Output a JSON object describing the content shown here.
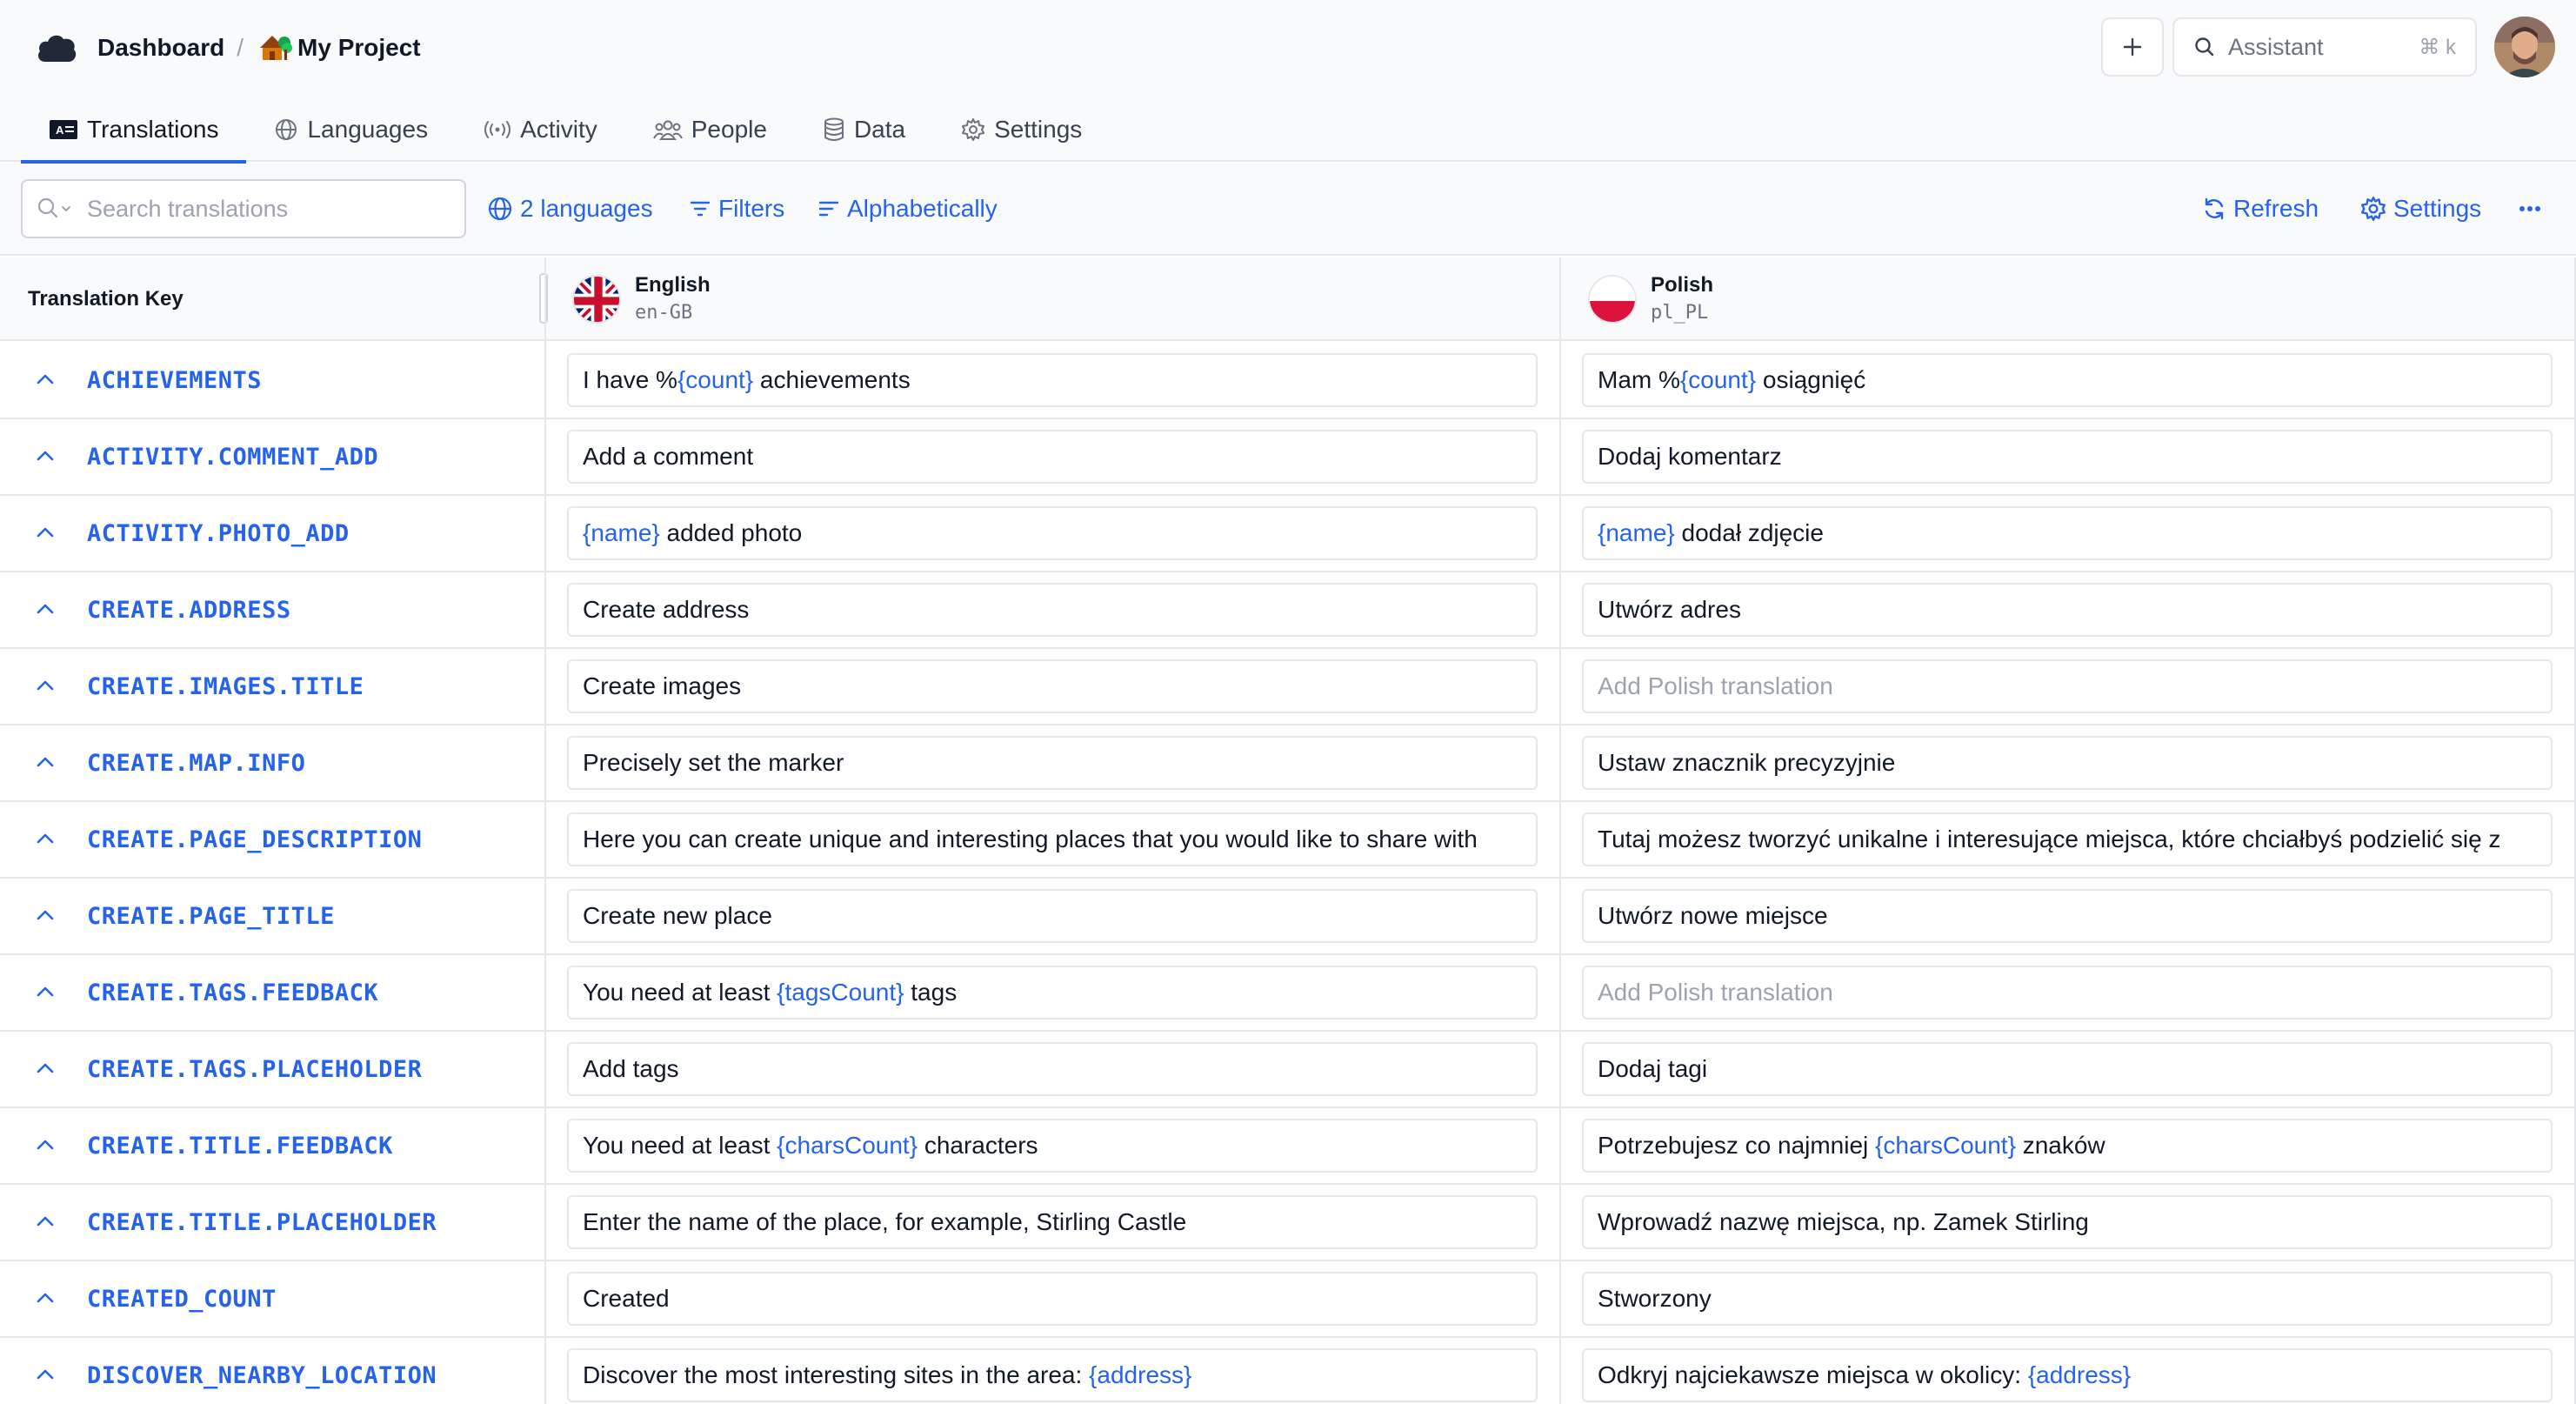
{
  "header": {
    "dashboard_label": "Dashboard",
    "separator": "/",
    "project_label": "My Project",
    "assistant_label": "Assistant",
    "assistant_shortcut": "⌘ k"
  },
  "tabs": [
    {
      "label": "Translations",
      "icon": "translations-icon",
      "active": true
    },
    {
      "label": "Languages",
      "icon": "globe-icon"
    },
    {
      "label": "Activity",
      "icon": "broadcast-icon"
    },
    {
      "label": "People",
      "icon": "people-icon"
    },
    {
      "label": "Data",
      "icon": "database-icon"
    },
    {
      "label": "Settings",
      "icon": "gear-icon"
    }
  ],
  "toolbar": {
    "search_placeholder": "Search translations",
    "languages_label": "2 languages",
    "filters_label": "Filters",
    "sort_label": "Alphabetically",
    "refresh_label": "Refresh",
    "settings_label": "Settings"
  },
  "grid": {
    "key_header": "Translation Key",
    "languages": [
      {
        "name": "English",
        "code": "en-GB",
        "flag": "uk-flag-icon"
      },
      {
        "name": "Polish",
        "code": "pl_PL",
        "flag": "poland-flag-icon"
      }
    ],
    "rows": [
      {
        "key": "ACHIEVEMENTS",
        "en": [
          {
            "t": "I have %"
          },
          {
            "p": "{count}"
          },
          {
            "t": " achievements"
          }
        ],
        "pl": [
          {
            "t": "Mam %"
          },
          {
            "p": "{count}"
          },
          {
            "t": " osiągnięć"
          }
        ]
      },
      {
        "key": "ACTIVITY.COMMENT_ADD",
        "en": [
          {
            "t": "Add a comment"
          }
        ],
        "pl": [
          {
            "t": "Dodaj komentarz"
          }
        ]
      },
      {
        "key": "ACTIVITY.PHOTO_ADD",
        "en": [
          {
            "p": "{name}"
          },
          {
            "t": " added photo"
          }
        ],
        "pl": [
          {
            "p": "{name}"
          },
          {
            "t": " dodał zdjęcie"
          }
        ]
      },
      {
        "key": "CREATE.ADDRESS",
        "en": [
          {
            "t": "Create address"
          }
        ],
        "pl": [
          {
            "t": "Utwórz adres"
          }
        ]
      },
      {
        "key": "CREATE.IMAGES.TITLE",
        "en": [
          {
            "t": "Create images"
          }
        ],
        "pl": [
          {
            "m": "Add Polish translation"
          }
        ]
      },
      {
        "key": "CREATE.MAP.INFO",
        "en": [
          {
            "t": "Precisely set the marker"
          }
        ],
        "pl": [
          {
            "t": "Ustaw znacznik precyzyjnie"
          }
        ]
      },
      {
        "key": "CREATE.PAGE_DESCRIPTION",
        "en": [
          {
            "t": "Here you can create unique and interesting places that you would like to share with"
          }
        ],
        "pl": [
          {
            "t": "Tutaj możesz tworzyć unikalne i interesujące miejsca, które chciałbyś podzielić się z"
          }
        ]
      },
      {
        "key": "CREATE.PAGE_TITLE",
        "en": [
          {
            "t": "Create new place"
          }
        ],
        "pl": [
          {
            "t": "Utwórz nowe miejsce"
          }
        ]
      },
      {
        "key": "CREATE.TAGS.FEEDBACK",
        "en": [
          {
            "t": "You need at least "
          },
          {
            "p": "{tagsCount}"
          },
          {
            "t": " tags"
          }
        ],
        "pl": [
          {
            "m": "Add Polish translation"
          }
        ]
      },
      {
        "key": "CREATE.TAGS.PLACEHOLDER",
        "en": [
          {
            "t": "Add tags"
          }
        ],
        "pl": [
          {
            "t": "Dodaj tagi"
          }
        ]
      },
      {
        "key": "CREATE.TITLE.FEEDBACK",
        "en": [
          {
            "t": "You need at least "
          },
          {
            "p": "{charsCount}"
          },
          {
            "t": " characters"
          }
        ],
        "pl": [
          {
            "t": "Potrzebujesz co najmniej "
          },
          {
            "p": "{charsCount}"
          },
          {
            "t": " znaków"
          }
        ]
      },
      {
        "key": "CREATE.TITLE.PLACEHOLDER",
        "en": [
          {
            "t": "Enter the name of the place, for example, Stirling Castle"
          }
        ],
        "pl": [
          {
            "t": "Wprowadź nazwę miejsca, np. Zamek Stirling"
          }
        ]
      },
      {
        "key": "CREATED_COUNT",
        "en": [
          {
            "t": "Created"
          }
        ],
        "pl": [
          {
            "t": "Stworzony"
          }
        ]
      },
      {
        "key": "DISCOVER_NEARBY_LOCATION",
        "en": [
          {
            "t": "Discover the most interesting sites in the area: "
          },
          {
            "p": "{address}"
          }
        ],
        "pl": [
          {
            "t": "Odkryj najciekawsze miejsca w okolicy: "
          },
          {
            "p": "{address}"
          }
        ]
      }
    ]
  },
  "colors": {
    "accent": "#2563eb",
    "border": "#e5e7eb",
    "muted": "#9ca3af"
  }
}
